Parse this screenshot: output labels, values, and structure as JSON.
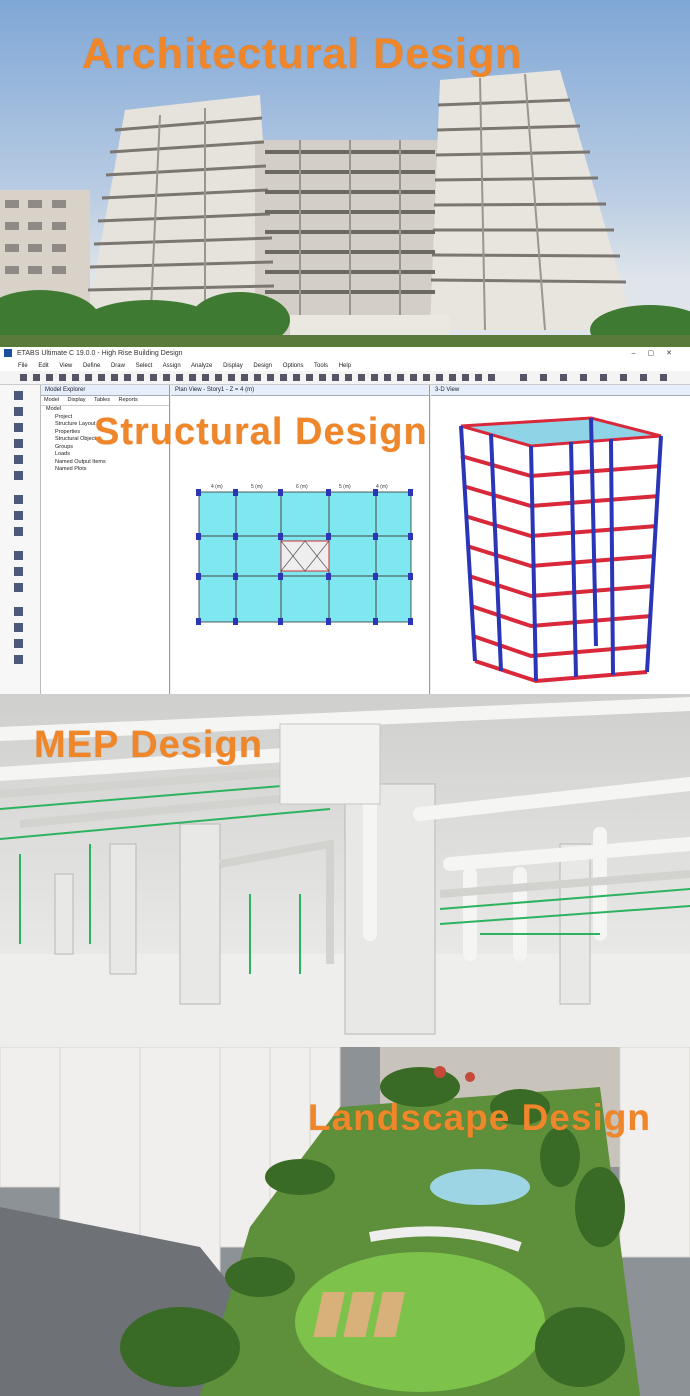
{
  "sections": {
    "architectural": {
      "title": "Architectural Design"
    },
    "structural": {
      "title": "Structural Design",
      "window_title": "ETABS Ultimate C 19.0.0 - High Rise Building Design",
      "menu": [
        "File",
        "Edit",
        "View",
        "Define",
        "Draw",
        "Select",
        "Assign",
        "Analyze",
        "Display",
        "Design",
        "Options",
        "Tools",
        "Help"
      ],
      "explorer_title": "Model Explorer",
      "explorer_tabs": [
        "Model",
        "Display",
        "Tables",
        "Reports"
      ],
      "tree_root": "Model",
      "tree_items": [
        "Project",
        "Structure Layout",
        "Properties",
        "Structural Objects",
        "Groups",
        "Loads",
        "Named Output Items",
        "Named Plots"
      ],
      "plan_title": "Plan View - Story1 - Z = 4 (m)",
      "view3d_title": "3-D View",
      "plan_dims": [
        "4 (m)",
        "5 (m)",
        "6 (m)",
        "5 (m)",
        "4 (m)"
      ]
    },
    "mep": {
      "title": "MEP Design"
    },
    "landscape": {
      "title": "Landscape Design"
    }
  },
  "colors": {
    "title_orange": "#f0862a",
    "slab_cyan": "#7fe7ef",
    "column_blue": "#2a35b8",
    "beam_red": "#d8283a"
  }
}
